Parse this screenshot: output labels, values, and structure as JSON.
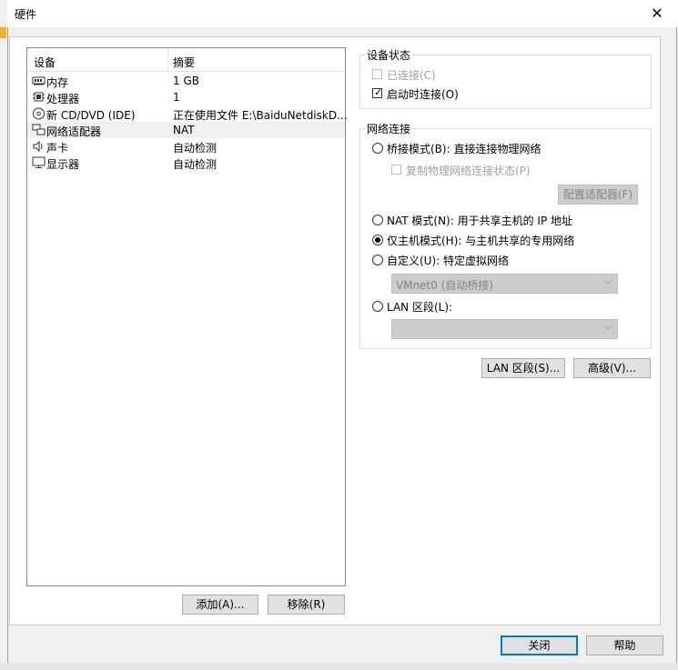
{
  "window": {
    "title": "硬件",
    "close_glyph": "✕"
  },
  "device_list": {
    "headers": {
      "device": "设备",
      "summary": "摘要"
    },
    "rows": [
      {
        "icon": "memory-icon",
        "name": "内存",
        "summary": "1 GB"
      },
      {
        "icon": "processor-icon",
        "name": "处理器",
        "summary": "1"
      },
      {
        "icon": "cd-dvd-icon",
        "name": "新 CD/DVD (IDE)",
        "summary": "正在使用文件 E:\\BaiduNetdiskD..."
      },
      {
        "icon": "network-adapter-icon",
        "name": "网络适配器",
        "summary": "NAT"
      },
      {
        "icon": "sound-card-icon",
        "name": "声卡",
        "summary": "自动检测"
      },
      {
        "icon": "display-icon",
        "name": "显示器",
        "summary": "自动检测"
      }
    ],
    "selected_index": 3
  },
  "list_buttons": {
    "add": "添加(A)...",
    "remove": "移除(R)"
  },
  "device_status": {
    "title": "设备状态",
    "connected": {
      "label": "已连接(C)",
      "checked": false,
      "enabled": false
    },
    "connect_at_power_on": {
      "label": "启动时连接(O)",
      "checked": true,
      "enabled": true
    }
  },
  "network_connection": {
    "title": "网络连接",
    "bridged": {
      "label": "桥接模式(B): 直接连接物理网络",
      "selected": false
    },
    "replicate": {
      "label": "复制物理网络连接状态(P)",
      "checked": false,
      "enabled": false
    },
    "configure_adapters": "配置适配器(F)",
    "nat": {
      "label": "NAT 模式(N): 用于共享主机的 IP 地址",
      "selected": false
    },
    "host_only": {
      "label": "仅主机模式(H): 与主机共享的专用网络",
      "selected": true
    },
    "custom": {
      "label": "自定义(U): 特定虚拟网络",
      "selected": false
    },
    "custom_select_value": "VMnet0 (自动桥接)",
    "lan_segment": {
      "label": "LAN 区段(L):",
      "selected": false
    },
    "lan_select_value": ""
  },
  "action_buttons": {
    "lan_segments": "LAN 区段(S)...",
    "advanced": "高级(V)..."
  },
  "footer": {
    "close": "关闭",
    "help": "帮助"
  }
}
